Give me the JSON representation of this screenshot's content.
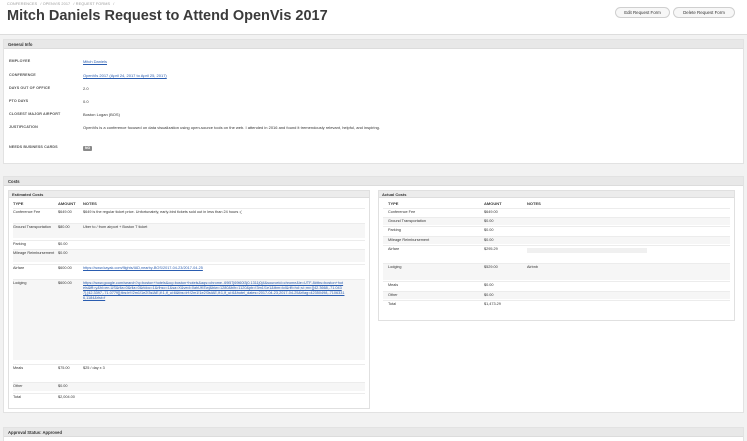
{
  "breadcrumb": [
    "CONFERENCES",
    "OPENVIS 2017",
    "REQUEST FORMS"
  ],
  "page_title": "Mitch Daniels Request to Attend OpenVis 2017",
  "buttons": {
    "edit": "Edit Request Form",
    "delete": "Delete Request Form"
  },
  "general_info": {
    "heading": "General Info",
    "rows": [
      {
        "label": "EMPLOYEE",
        "value": "Mitch Daniels",
        "link": true
      },
      {
        "label": "CONFERENCE",
        "value": "OpenVis 2017 (April 24, 2017 to April 25, 2017)",
        "link": true
      },
      {
        "label": "DAYS OUT OF OFFICE",
        "value": "2.0",
        "link": false
      },
      {
        "label": "PTO DAYS",
        "value": "0.0",
        "link": false
      },
      {
        "label": "CLOSEST MAJOR AIRPORT",
        "value": "Boston Logan (BOS)",
        "link": false
      },
      {
        "label": "JUSTIFICATION",
        "value": "OpenVis is a conference focused on data visualization using open-source tools on the web. I attended in 2016 and found it tremendously relevant, helpful, and inspiring.",
        "link": false
      }
    ],
    "business_cards_label": "NEEDS BUSINESS CARDS",
    "business_cards_value": "NO"
  },
  "costs": {
    "heading": "Costs",
    "estimated": {
      "heading": "Estimated Costs",
      "columns": [
        "TYPE",
        "AMOUNT",
        "NOTES"
      ],
      "rows": [
        {
          "type": "Conference Fee",
          "amount": "$649.00",
          "notes": "$649 is the regular ticket price. Unfortunately, early-bird tickets sold out in less than 24 hours :(",
          "link": false
        },
        {
          "type": "Ground Transportation",
          "amount": "$80.00",
          "notes": "Uber to / from airport + Boston T ticket",
          "link": false
        },
        {
          "type": "Parking",
          "amount": "$0.00",
          "notes": "",
          "link": false
        },
        {
          "type": "Mileage Reimbursement",
          "amount": "$0.00",
          "notes": "",
          "link": false
        },
        {
          "type": "Airfare",
          "amount": "$600.00",
          "notes": "https://www.kayak.com/flights/IAD,nearby-BOS/2017-04-23/2017-04-25",
          "link": true
        },
        {
          "type": "Lodging",
          "amount": "$600.00",
          "notes": "https://www.google.com/search?q=boston+hotels&oq=boston+hotels&aqs=chrome..69i57j69i60l3j0.1311j0j4&sourceid=chrome&ie=UTF-8#tbs=boston+hotels&ffl=y&hl=en-US&rlla=0&rlla=0&rldoc=1&rlhsc=1&sa=X&ved=0ahUKEwj&biw=1280&bih=1120&pb=!3m1!1e1&tbm=lcl&rlfi=hd:;si:;mv:[[42.3668,-71.0437],[42.3397,-71.0779]];tbs:lrf:!2m1!1e2!3sIAE,lf:1,lf_ui:6&tbs=lrf:!2m1!1e2!3sIAE,lf:1,lf_ui:6&hotel_dates=2017-04-23,2017-04-25&rllag=42350498,-71063316,1184&rlst=f",
          "link": true
        },
        {
          "type": "Meals",
          "amount": "$75.00",
          "notes": "$25 / day x 3",
          "link": false
        },
        {
          "type": "Other",
          "amount": "$0.00",
          "notes": "",
          "link": false
        },
        {
          "type": "Total",
          "amount": "$2,004.00",
          "notes": "",
          "link": false
        }
      ]
    },
    "actual": {
      "heading": "Actual Costs",
      "columns": [
        "TYPE",
        "AMOUNT",
        "NOTES"
      ],
      "rows": [
        {
          "type": "Conference Fee",
          "amount": "$649.00",
          "notes": ""
        },
        {
          "type": "Ground Transportation",
          "amount": "$0.00",
          "notes": ""
        },
        {
          "type": "Parking",
          "amount": "$0.00",
          "notes": ""
        },
        {
          "type": "Mileage Reimbursement",
          "amount": "$0.00",
          "notes": ""
        },
        {
          "type": "Airfare",
          "amount": "$295.29",
          "notes": ""
        },
        {
          "type": "Lodging",
          "amount": "$529.00",
          "notes": "Airbnb"
        },
        {
          "type": "Meals",
          "amount": "$0.00",
          "notes": ""
        },
        {
          "type": "Other",
          "amount": "$0.00",
          "notes": ""
        },
        {
          "type": "Total",
          "amount": "$1,473.29",
          "notes": ""
        }
      ]
    }
  },
  "approval_status": "Approval Status: Approved"
}
